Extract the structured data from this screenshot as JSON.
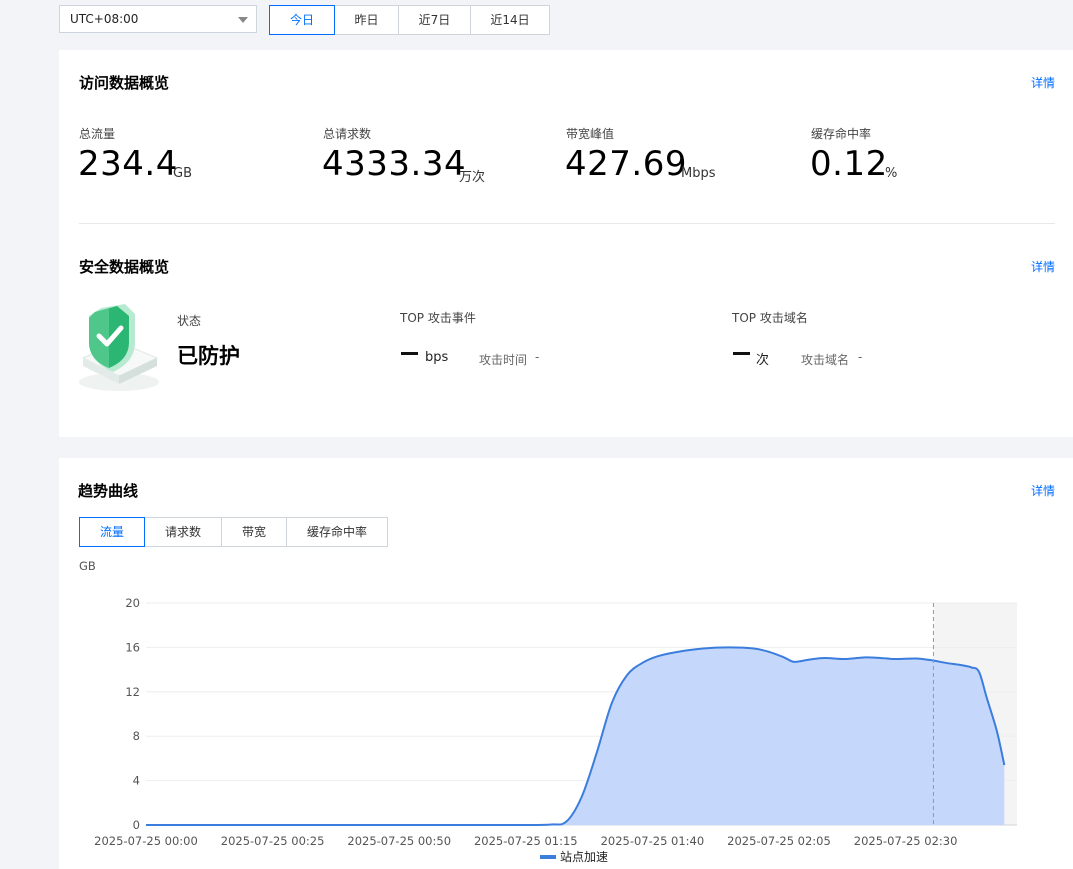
{
  "filters": {
    "timezone": "UTC+08:00",
    "ranges": [
      {
        "label": "今日",
        "active": true
      },
      {
        "label": "昨日",
        "active": false
      },
      {
        "label": "近7日",
        "active": false
      },
      {
        "label": "近14日",
        "active": false
      }
    ]
  },
  "visit_overview": {
    "title": "访问数据概览",
    "detail_label": "详情",
    "metrics": [
      {
        "label": "总流量",
        "value": "234.4",
        "unit": "GB"
      },
      {
        "label": "总请求数",
        "value": "4333.34",
        "unit": "万次"
      },
      {
        "label": "带宽峰值",
        "value": "427.69",
        "unit": "Mbps"
      },
      {
        "label": "缓存命中率",
        "value": "0.12",
        "unit": "%"
      }
    ]
  },
  "security_overview": {
    "title": "安全数据概览",
    "detail_label": "详情",
    "status_label": "状态",
    "status_value": "已防护",
    "top_attack_event": {
      "label": "TOP 攻击事件",
      "unit": "bps",
      "time_label": "攻击时间",
      "time_value": "-"
    },
    "top_attack_domain": {
      "label": "TOP 攻击域名",
      "unit": "次",
      "domain_label": "攻击域名",
      "domain_value": "-"
    },
    "shield_icon": "shield-check-icon",
    "status_color": "#2bb673"
  },
  "trend": {
    "title": "趋势曲线",
    "detail_label": "详情",
    "tabs": [
      {
        "label": "流量",
        "active": true
      },
      {
        "label": "请求数",
        "active": false
      },
      {
        "label": "带宽",
        "active": false
      },
      {
        "label": "缓存命中率",
        "active": false
      }
    ],
    "unit_label": "GB",
    "legend_label": "站点加速"
  },
  "chart_data": {
    "type": "area",
    "ylabel": "GB",
    "ylim": [
      0,
      20
    ],
    "yticks": [
      0,
      4,
      8,
      12,
      16,
      20
    ],
    "xtick_labels": [
      "2025-07-25 00:00",
      "2025-07-25 00:25",
      "2025-07-25 00:50",
      "2025-07-25 01:15",
      "2025-07-25 01:40",
      "2025-07-25 02:05",
      "2025-07-25 02:30"
    ],
    "x_start_minutes": 0,
    "x_end_minutes": 165,
    "series": [
      {
        "name": "站点加速",
        "color": "#3b7ddd",
        "fill": "#c2d6fb",
        "points": [
          [
            0,
            0
          ],
          [
            10,
            0
          ],
          [
            20,
            0
          ],
          [
            30,
            0
          ],
          [
            40,
            0
          ],
          [
            50,
            0
          ],
          [
            60,
            0
          ],
          [
            70,
            0
          ],
          [
            75,
            0
          ],
          [
            80,
            0.05
          ],
          [
            83,
            0.3
          ],
          [
            86,
            2.5
          ],
          [
            89,
            6.5
          ],
          [
            92,
            11
          ],
          [
            95,
            13.5
          ],
          [
            98,
            14.6
          ],
          [
            101,
            15.2
          ],
          [
            105,
            15.6
          ],
          [
            110,
            15.9
          ],
          [
            115,
            16.0
          ],
          [
            120,
            15.9
          ],
          [
            123,
            15.6
          ],
          [
            126,
            15.1
          ],
          [
            128,
            14.7
          ],
          [
            131,
            14.9
          ],
          [
            134,
            15.05
          ],
          [
            138,
            14.95
          ],
          [
            142,
            15.1
          ],
          [
            145,
            15.05
          ],
          [
            148,
            14.95
          ],
          [
            152,
            15.0
          ],
          [
            155,
            14.85
          ],
          [
            158,
            14.6
          ],
          [
            161,
            14.4
          ],
          [
            163,
            14.2
          ],
          [
            164.5,
            13.8
          ],
          [
            166,
            11.5
          ],
          [
            168,
            8.5
          ],
          [
            169.5,
            5.4
          ]
        ]
      }
    ],
    "highlight_start_minutes": 155.5,
    "grid": true,
    "legend_position": "bottom-center"
  }
}
